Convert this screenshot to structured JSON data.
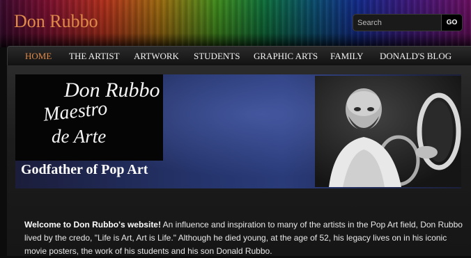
{
  "header": {
    "site_title": "Don Rubbo",
    "search": {
      "placeholder": "Search",
      "button_label": "GO"
    }
  },
  "nav": {
    "items": [
      {
        "label": "HOME",
        "active": true
      },
      {
        "label": "THE ARTIST"
      },
      {
        "label": "ARTWORK"
      },
      {
        "label": "STUDENTS"
      },
      {
        "label": "GRAPHIC ARTS"
      },
      {
        "label": "FAMILY"
      },
      {
        "label": "DONALD'S BLOG"
      }
    ]
  },
  "banner": {
    "logo_lines": [
      "Don Rubbo",
      "Maestro",
      "de Arte"
    ],
    "tagline": "Godfather of Pop Art",
    "photo_icon": "portrait-photo"
  },
  "content": {
    "intro_bold": "Welcome to Don Rubbo's website!",
    "intro_text": " An influence and inspiration to many of the artists in the Pop Art field, Don Rubbo lived by the credo, \"Life is Art, Art is Life.\" Although he died young, at the age of 52, his legacy lives on in his iconic movie posters, the work of his students and his son Donald Rubbo."
  },
  "colors": {
    "accent": "#e08a4a",
    "nav_text": "#f2f2f2",
    "background": "#0c0c0c"
  }
}
